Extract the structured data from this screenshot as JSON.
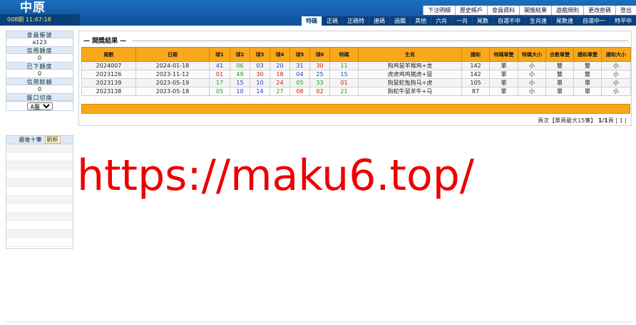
{
  "header": {
    "logo": "中原",
    "period": "008期 11:47:18",
    "top_links": [
      "下注明細",
      "歷史帳戶",
      "會員資料",
      "開獎結果",
      "遊戲規則",
      "更改密碼",
      "登出"
    ],
    "tabs": [
      "特碼",
      "正碼",
      "正碼特",
      "連碼",
      "過關",
      "其他",
      "六肖",
      "一肖",
      "尾數",
      "自選不中",
      "生肖連",
      "尾數連",
      "自選中一",
      "特平中"
    ],
    "active_tab": "特碼"
  },
  "sidebar": {
    "account_label": "會員帳號",
    "account_value": "a123",
    "credit_label": "信用額度",
    "credit_value": "0",
    "placed_label": "已下額度",
    "placed_value": "0",
    "balance_label": "信用餘額",
    "balance_value": "0",
    "switch_label": "盤口切換",
    "switch_value": "A盤",
    "recent_title": "最後十筆",
    "refresh_label": "刷新"
  },
  "main": {
    "panel_title": "開獎結果",
    "columns": [
      "期數",
      "日期",
      "球1",
      "球2",
      "球3",
      "球4",
      "球5",
      "球6",
      "特碼",
      "生肖",
      "總和",
      "特碼單雙",
      "特碼大小",
      "合數單雙",
      "總和單雙",
      "總和大小"
    ],
    "rows": [
      {
        "issue": "2024007",
        "date": "2024-01-18",
        "balls": [
          [
            "41",
            "blue"
          ],
          [
            "06",
            "green"
          ],
          [
            "03",
            "blue"
          ],
          [
            "20",
            "blue"
          ],
          [
            "31",
            "blue"
          ],
          [
            "30",
            "red"
          ]
        ],
        "special": [
          "11",
          "green"
        ],
        "zodiac": "狗鸡鼠羊猴鸡+龙",
        "sum": "142",
        "s_oe": "單",
        "s_bs": "小",
        "c_oe": "雙",
        "t_oe": "雙",
        "t_bs": "小"
      },
      {
        "issue": "2023126",
        "date": "2023-11-12",
        "balls": [
          [
            "01",
            "red"
          ],
          [
            "49",
            "green"
          ],
          [
            "30",
            "red"
          ],
          [
            "18",
            "red"
          ],
          [
            "04",
            "blue"
          ],
          [
            "25",
            "blue"
          ]
        ],
        "special": [
          "15",
          "blue"
        ],
        "zodiac": "虎虎鸡鸡猪虎+鼠",
        "sum": "142",
        "s_oe": "單",
        "s_bs": "小",
        "c_oe": "雙",
        "t_oe": "雙",
        "t_bs": "小"
      },
      {
        "issue": "2023139",
        "date": "2023-05-19",
        "balls": [
          [
            "17",
            "green"
          ],
          [
            "15",
            "blue"
          ],
          [
            "10",
            "blue"
          ],
          [
            "24",
            "red"
          ],
          [
            "05",
            "green"
          ],
          [
            "33",
            "green"
          ]
        ],
        "special": [
          "01",
          "red"
        ],
        "zodiac": "狗鼠蛇兔狗马+虎",
        "sum": "105",
        "s_oe": "單",
        "s_bs": "小",
        "c_oe": "單",
        "t_oe": "單",
        "t_bs": "小"
      },
      {
        "issue": "2023138",
        "date": "2023-05-18",
        "balls": [
          [
            "05",
            "green"
          ],
          [
            "10",
            "blue"
          ],
          [
            "14",
            "blue"
          ],
          [
            "27",
            "green"
          ],
          [
            "08",
            "red"
          ],
          [
            "02",
            "red"
          ]
        ],
        "special": [
          "21",
          "green"
        ],
        "zodiac": "狗蛇牛鼠羊牛+马",
        "sum": "87",
        "s_oe": "單",
        "s_bs": "小",
        "c_oe": "單",
        "t_oe": "單",
        "t_bs": "小"
      }
    ],
    "pager_prefix": "頁次【單頁最大15筆】",
    "pager_pages": "1/1",
    "pager_unit": "頁",
    "pager_links": "| 1 |"
  },
  "colors": {
    "blue": "#2233cc",
    "green": "#1a9a1a",
    "red": "#dd1111",
    "header_orange": "#f8a81a"
  },
  "watermark": "https://maku6.top/"
}
